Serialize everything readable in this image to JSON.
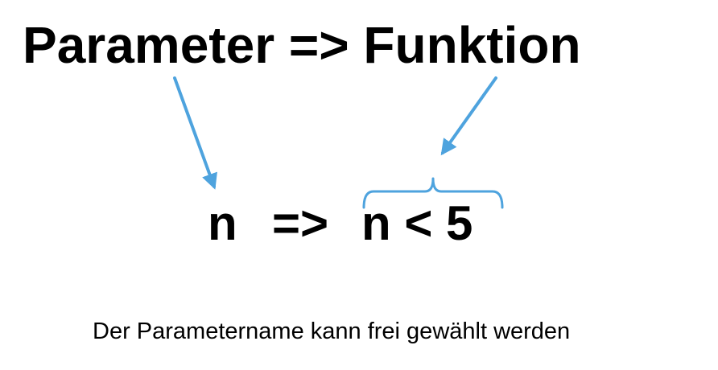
{
  "heading": {
    "left": "Parameter",
    "operator": "=>",
    "right": "Funktion"
  },
  "expression": {
    "parameter": "n",
    "arrow": "=>",
    "body": "n < 5"
  },
  "caption": "Der Parametername kann frei gewählt werden",
  "colors": {
    "text": "#000000",
    "arrow": "#4ea3de"
  }
}
